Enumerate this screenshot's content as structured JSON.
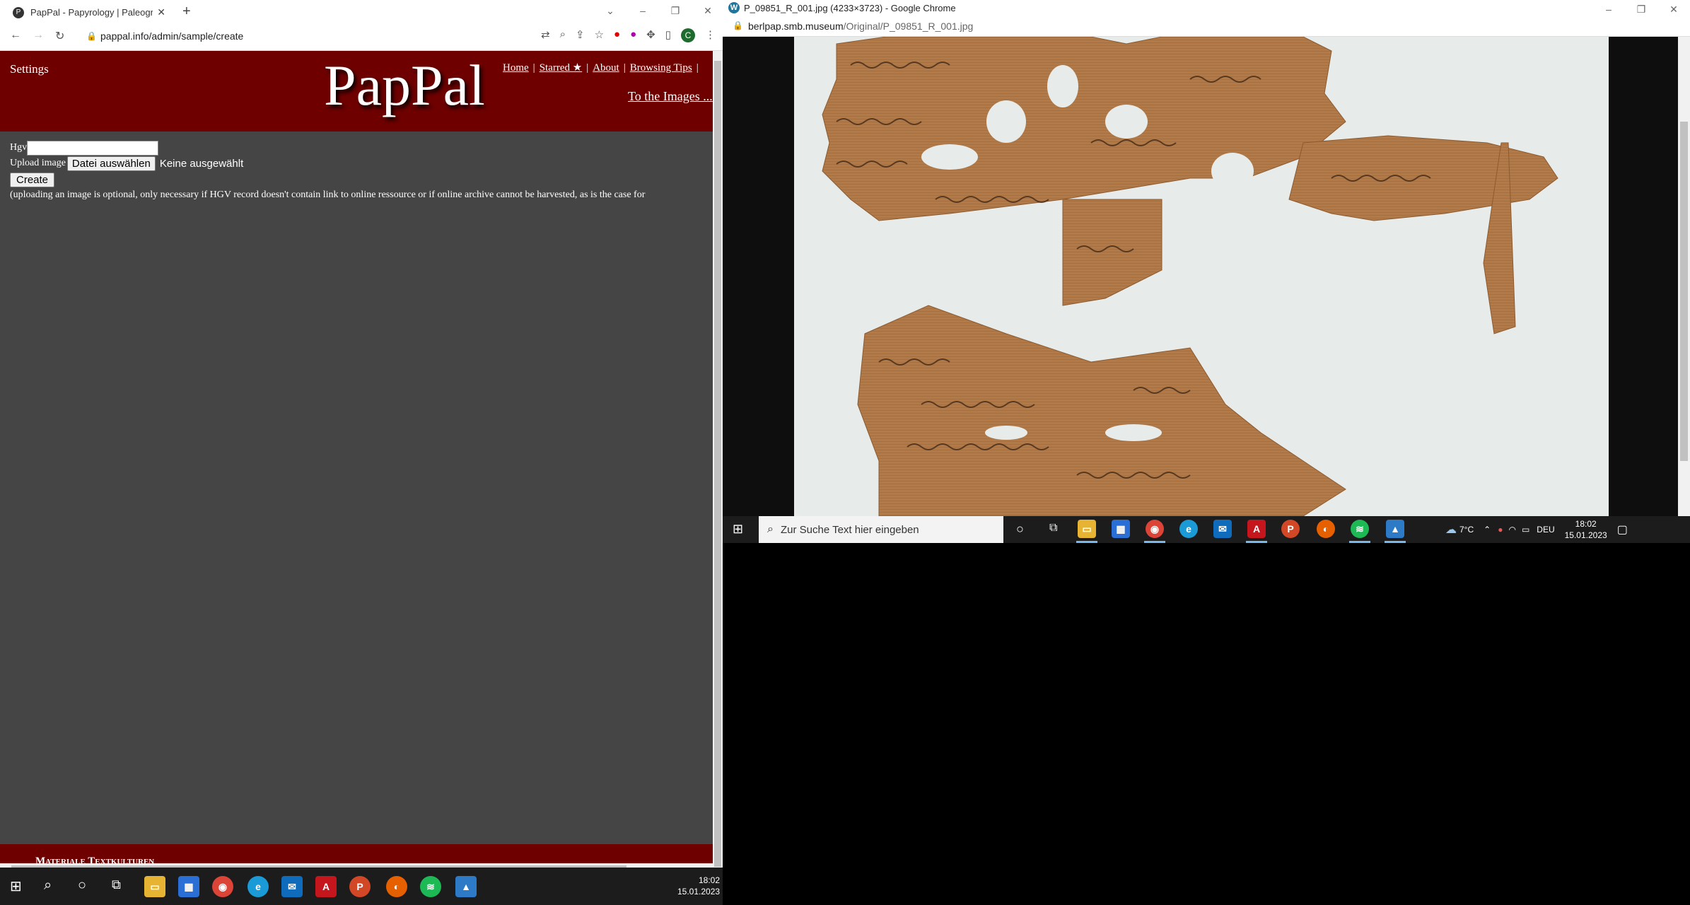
{
  "left_browser": {
    "tab_title": "PapPal - Papyrology | Paleograph",
    "url": "pappal.info/admin/sample/create",
    "site": {
      "settings_label": "Settings",
      "logo": "PapPal",
      "nav": [
        "Home",
        "Starred ★",
        "About",
        "Browsing Tips"
      ],
      "images_link": "To the Images ...",
      "form": {
        "hgv_label": "Hgv",
        "upload_label": "Upload image",
        "file_button": "Datei auswählen",
        "no_file": "Keine ausgewählt",
        "create_button": "Create",
        "note": "(uploading an image is optional, only necessary if HGV record doesn't contain link to online ressource or if online archive cannot be harvested, as is the case for"
      },
      "footer": "Materiale Textkulturen"
    }
  },
  "right_browser": {
    "window_title": "P_09851_R_001.jpg (4233×3723) - Google Chrome",
    "url_host": "berlpap.smb.museum",
    "url_path": "/Original/P_09851_R_001.jpg"
  },
  "right_taskbar": {
    "search_placeholder": "Zur Suche Text hier eingeben",
    "weather": "7°C",
    "lang": "DEU",
    "time": "18:02",
    "date": "15.01.2023"
  },
  "left_taskbar": {
    "time": "18:02",
    "date": "15.01.2023"
  },
  "colors": {
    "pappal_red": "#6e0000",
    "page_gray": "#454545",
    "papyrus": "#b07a48",
    "papyrus_bg": "#e7ecea"
  }
}
